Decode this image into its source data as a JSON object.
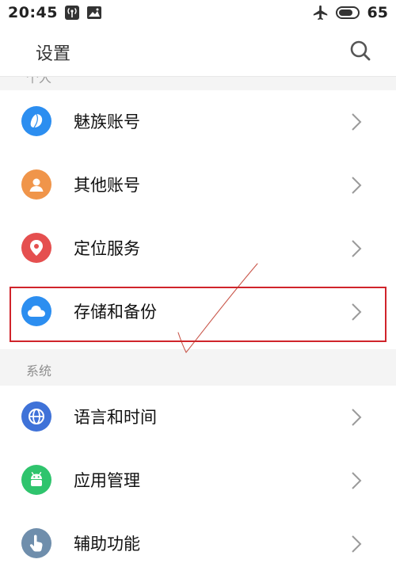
{
  "status_bar": {
    "time": "20:45",
    "battery_level": "65",
    "icons": [
      "wifi-hotspot-icon",
      "image-notification-icon",
      "airplane-mode-icon",
      "battery-icon"
    ]
  },
  "header": {
    "title": "设置",
    "search_icon": "search-icon"
  },
  "partial_section": {
    "label": "个人"
  },
  "account_items": [
    {
      "label": "魅族账号",
      "icon": "flyme-account-icon",
      "color": "#2c8ef0"
    },
    {
      "label": "其他账号",
      "icon": "person-icon",
      "color": "#f0954a"
    },
    {
      "label": "定位服务",
      "icon": "location-pin-icon",
      "color": "#e54f4f"
    },
    {
      "label": "存储和备份",
      "icon": "cloud-icon",
      "color": "#2c8ef0"
    }
  ],
  "system_section": {
    "label": "系统",
    "items": [
      {
        "label": "语言和时间",
        "icon": "globe-icon",
        "color": "#3f72d8"
      },
      {
        "label": "应用管理",
        "icon": "android-icon",
        "color": "#2fc46d"
      },
      {
        "label": "辅助功能",
        "icon": "hand-pointer-icon",
        "color": "#6f8eac"
      }
    ]
  },
  "colors": {
    "highlight": "#d0242b",
    "section_background": "#f4f4f4",
    "chevron": "#9a9a9a"
  }
}
